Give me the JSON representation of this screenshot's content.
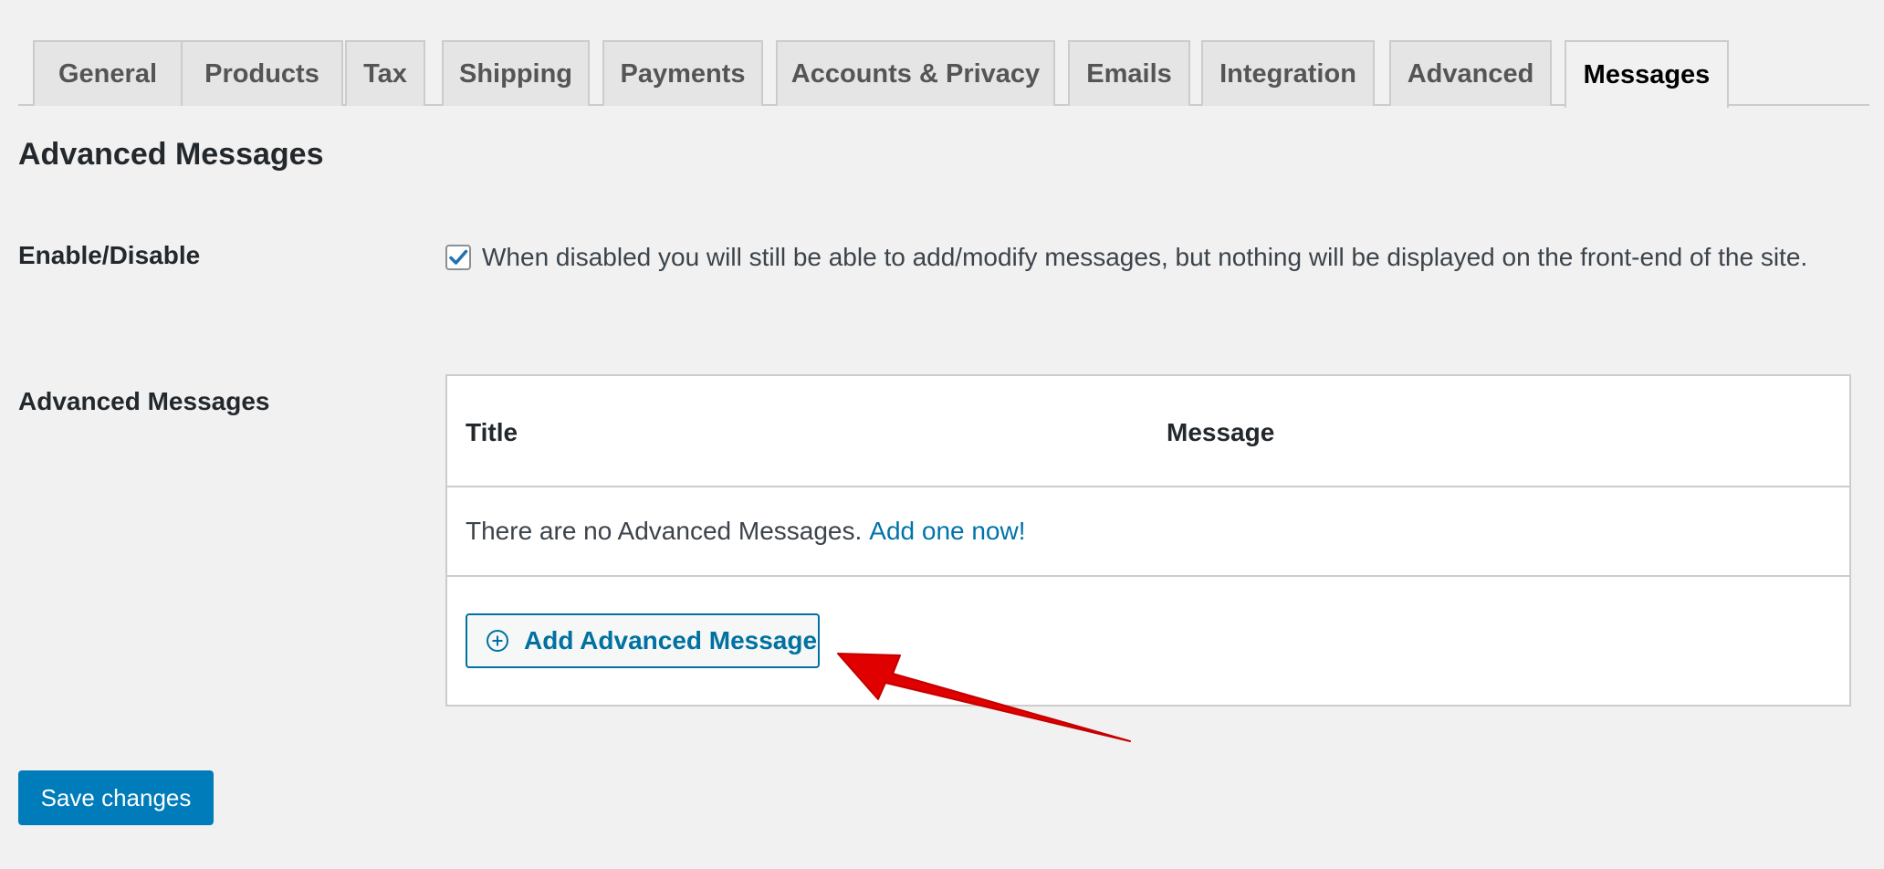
{
  "tabs": [
    {
      "label": "General"
    },
    {
      "label": "Products"
    },
    {
      "label": "Tax"
    },
    {
      "label": "Shipping"
    },
    {
      "label": "Payments"
    },
    {
      "label": "Accounts & Privacy"
    },
    {
      "label": "Emails"
    },
    {
      "label": "Integration"
    },
    {
      "label": "Advanced"
    },
    {
      "label": "Messages",
      "active": true
    }
  ],
  "page": {
    "section_title": "Advanced Messages"
  },
  "enable": {
    "label": "Enable/Disable",
    "checked": true,
    "description": "When disabled you will still be able to add/modify messages, but nothing will be displayed on the front-end of the site."
  },
  "messages": {
    "label": "Advanced Messages",
    "columns": [
      "Title",
      "Message"
    ],
    "empty_text": "There are no Advanced Messages.",
    "empty_link": "Add one now!",
    "add_button_label": "Add Advanced Message"
  },
  "save_button_label": "Save changes",
  "colors": {
    "accent": "#0073aa",
    "primary_button": "#007cba",
    "annotation_arrow": "#e00000"
  },
  "icons": {
    "checkbox": "checkmark-icon",
    "add_button": "plus-circle-icon",
    "annotation": "red-arrow-icon"
  }
}
